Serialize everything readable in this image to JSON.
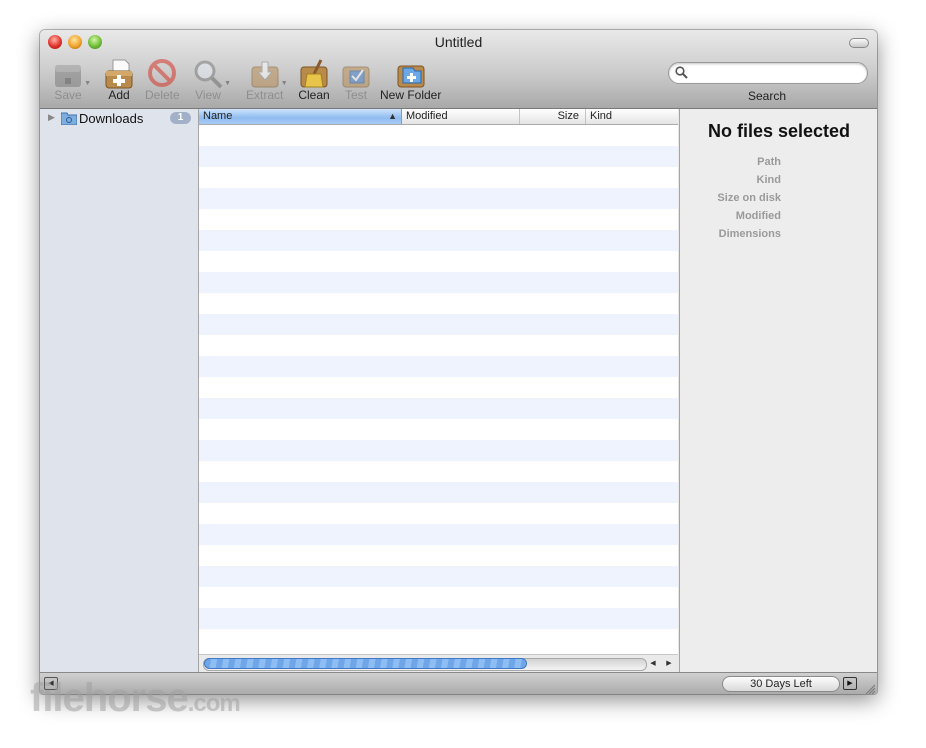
{
  "window": {
    "title": "Untitled"
  },
  "toolbar": {
    "save": "Save",
    "add": "Add",
    "delete": "Delete",
    "view": "View",
    "extract": "Extract",
    "clean": "Clean",
    "test": "Test",
    "new_folder": "New Folder",
    "search_label": "Search",
    "search_value": ""
  },
  "sidebar": {
    "items": [
      {
        "label": "Downloads",
        "badge": "1",
        "icon": "folder-icon"
      }
    ],
    "footer": {
      "add": "+",
      "remove": "−",
      "filter_value": ""
    }
  },
  "file_list": {
    "columns": [
      {
        "label": "Name",
        "sorted": "ascending"
      },
      {
        "label": "Modified"
      },
      {
        "label": "Size"
      },
      {
        "label": "Kind"
      }
    ],
    "rows": [],
    "scroll": {
      "horizontal_thumb_fraction": 0.73
    }
  },
  "info_panel": {
    "title": "No files selected",
    "fields": [
      "Path",
      "Kind",
      "Size on disk",
      "Modified",
      "Dimensions"
    ]
  },
  "status": {
    "trial": "30 Days Left"
  },
  "watermark": {
    "text": "filehorse",
    "suffix": ".com"
  },
  "colors": {
    "accent": "#8fbcf0",
    "row_stripe": "#eef3fd",
    "sidebar": "#dfe4ec"
  }
}
